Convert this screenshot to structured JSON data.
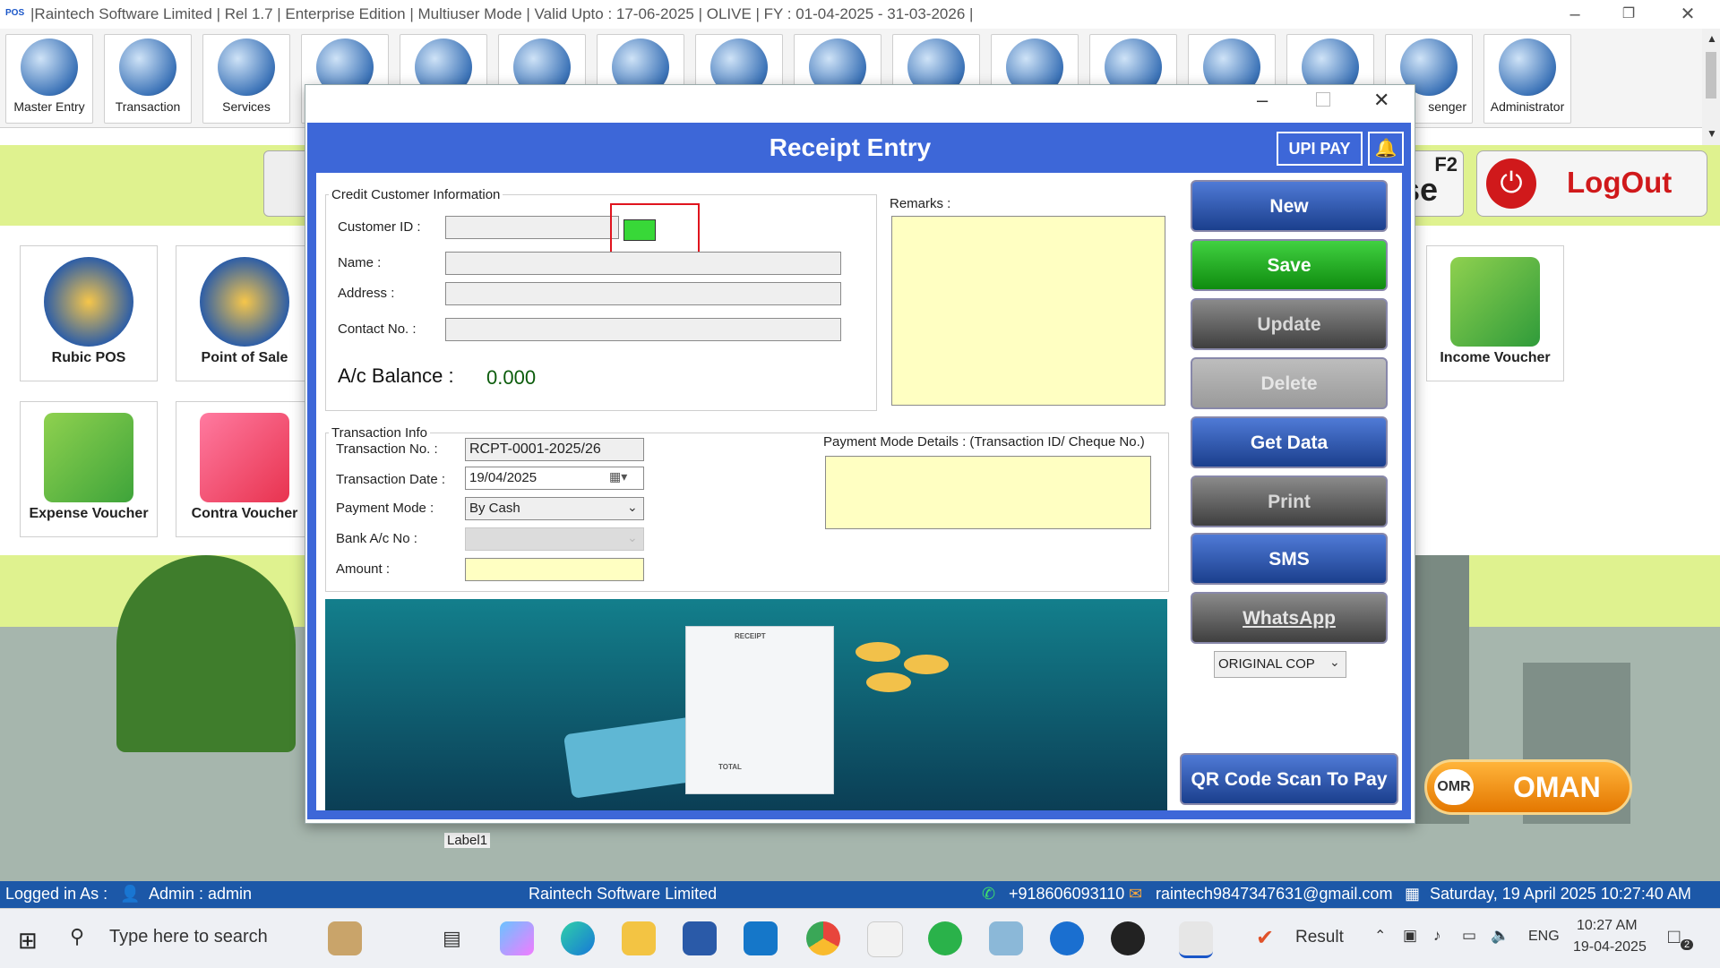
{
  "window": {
    "title": "|Raintech Software Limited |  Rel 1.7  |  Enterprise Edition  |  Multiuser Mode  |  Valid Upto : 17-06-2025  |  OLIVE  |  FY : 01-04-2025  -  31-03-2026  |",
    "logo": "POS"
  },
  "toolbar": {
    "items": [
      {
        "label": "Master Entry"
      },
      {
        "label": "Transaction"
      },
      {
        "label": "Services"
      },
      {
        "label": ""
      },
      {
        "label": ""
      },
      {
        "label": ""
      },
      {
        "label": ""
      },
      {
        "label": ""
      },
      {
        "label": ""
      },
      {
        "label": ""
      },
      {
        "label": ""
      },
      {
        "label": ""
      },
      {
        "label": ""
      },
      {
        "label": ""
      },
      {
        "label": "senger"
      },
      {
        "label": "Administrator"
      }
    ]
  },
  "desktop": {
    "tiles": [
      {
        "label": "Rubic POS"
      },
      {
        "label": "Point of Sale"
      },
      {
        "label": "Expense Voucher"
      },
      {
        "label": "Contra Voucher"
      },
      {
        "label": "Income Voucher"
      }
    ],
    "f2_label": "F2",
    "se_label": "se",
    "logout_label": "LogOut",
    "omr_label": "OMR",
    "oman_label": "OMAN",
    "label1": "Label1"
  },
  "dialog": {
    "title": "Receipt Entry",
    "upi_pay": "UPI PAY",
    "credit_group": "Credit Customer Information",
    "customer_id_label": "Customer ID :",
    "name_label": "Name :",
    "address_label": "Address :",
    "contact_label": "Contact No. :",
    "balance_label": "A/c Balance :",
    "balance_value": "0.000",
    "remarks_label": "Remarks :",
    "txn_group": "Transaction Info",
    "txn_no_label": "Transaction No. :",
    "txn_no_value": "RCPT-0001-2025/26",
    "txn_date_label": "Transaction Date :",
    "txn_date_value": "19/04/2025",
    "payment_mode_label": "Payment Mode :",
    "payment_mode_value": "By Cash",
    "bank_label": "Bank A/c No :",
    "amount_label": "Amount :",
    "payment_details_label": "Payment Mode Details : (Transaction ID/ Cheque No.)",
    "receipt_word": "RECEIPT",
    "total_word": "TOTAL",
    "buttons": {
      "new": "New",
      "save": "Save",
      "update": "Update",
      "delete": "Delete",
      "get_data": "Get Data",
      "print": "Print",
      "sms": "SMS",
      "whatsapp": "WhatsApp",
      "copy_select": "ORIGINAL COP",
      "qr": "QR Code Scan To Pay"
    }
  },
  "status": {
    "logged_in": "Logged in As :",
    "user": "Admin  :  admin",
    "company": "Raintech Software Limited",
    "phone": "+918606093110",
    "email": "raintech9847347631@gmail.com",
    "datetime": "Saturday, 19 April 2025 10:27:40 AM"
  },
  "taskbar": {
    "search_placeholder": "Type here to search",
    "result": "Result",
    "lang": "ENG",
    "time": "10:27 AM",
    "date": "19-04-2025",
    "notif_count": "2"
  },
  "colors": {
    "accent_blue": "#3d67d8",
    "status_blue": "#1c58a8",
    "save_green": "#1aa81a",
    "yellow_field": "#ffffc2",
    "logout_red": "#d0191b",
    "oman_orange": "#f08a0a"
  }
}
